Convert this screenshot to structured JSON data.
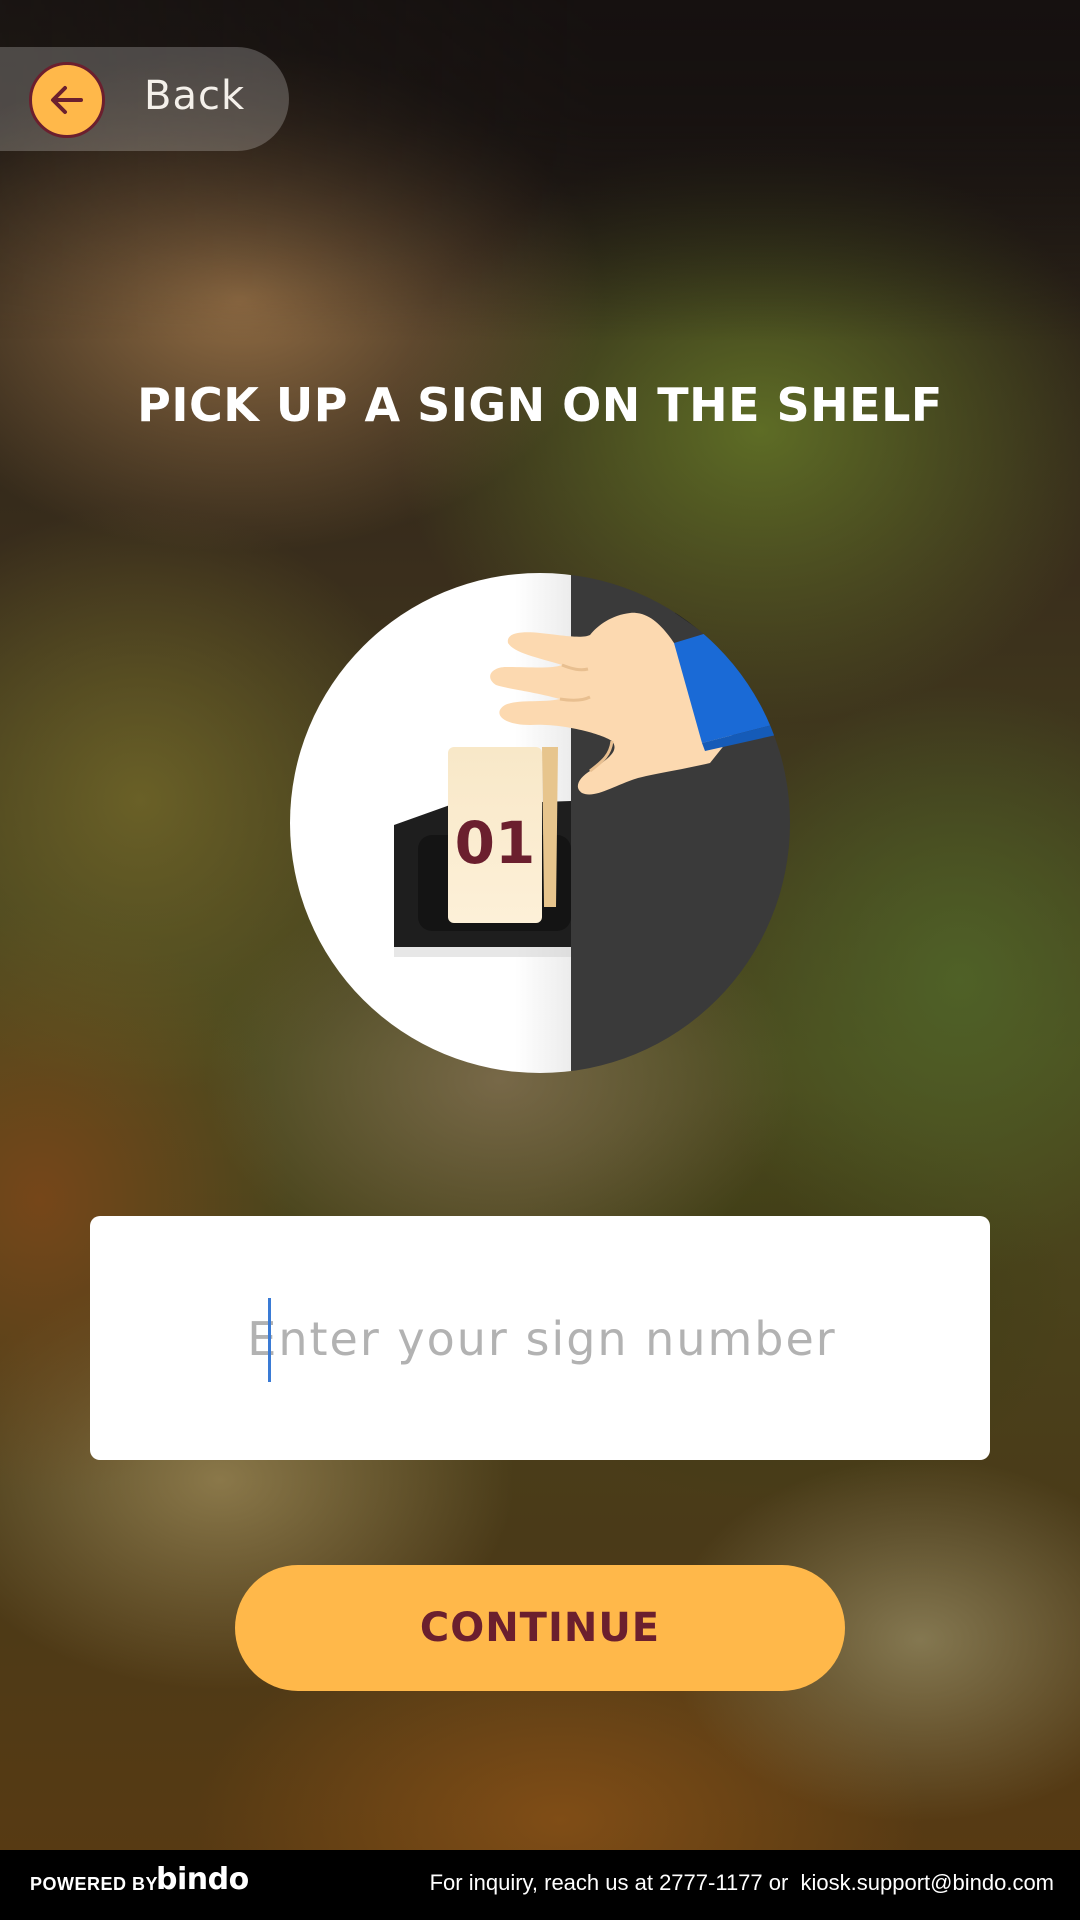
{
  "back": {
    "label": "Back"
  },
  "title": "PICK UP A SIGN ON THE SHELF",
  "illustration": {
    "sign_number": "01"
  },
  "sign_input": {
    "value": "",
    "placeholder": "Enter your sign number"
  },
  "continue_button": {
    "label": "CONTINUE"
  },
  "footer": {
    "powered_by": "POWERED BY",
    "logo": "bindo",
    "inquiry": "For inquiry, reach us at 2777-1177 or  kiosk.support@bindo.com"
  },
  "colors": {
    "accent": "#ffb84a",
    "accent_text": "#6b1f2e",
    "footer_bg": "#000000",
    "sleeve": "#1a6ad6"
  },
  "icons": {
    "back": "arrow-left-icon"
  }
}
